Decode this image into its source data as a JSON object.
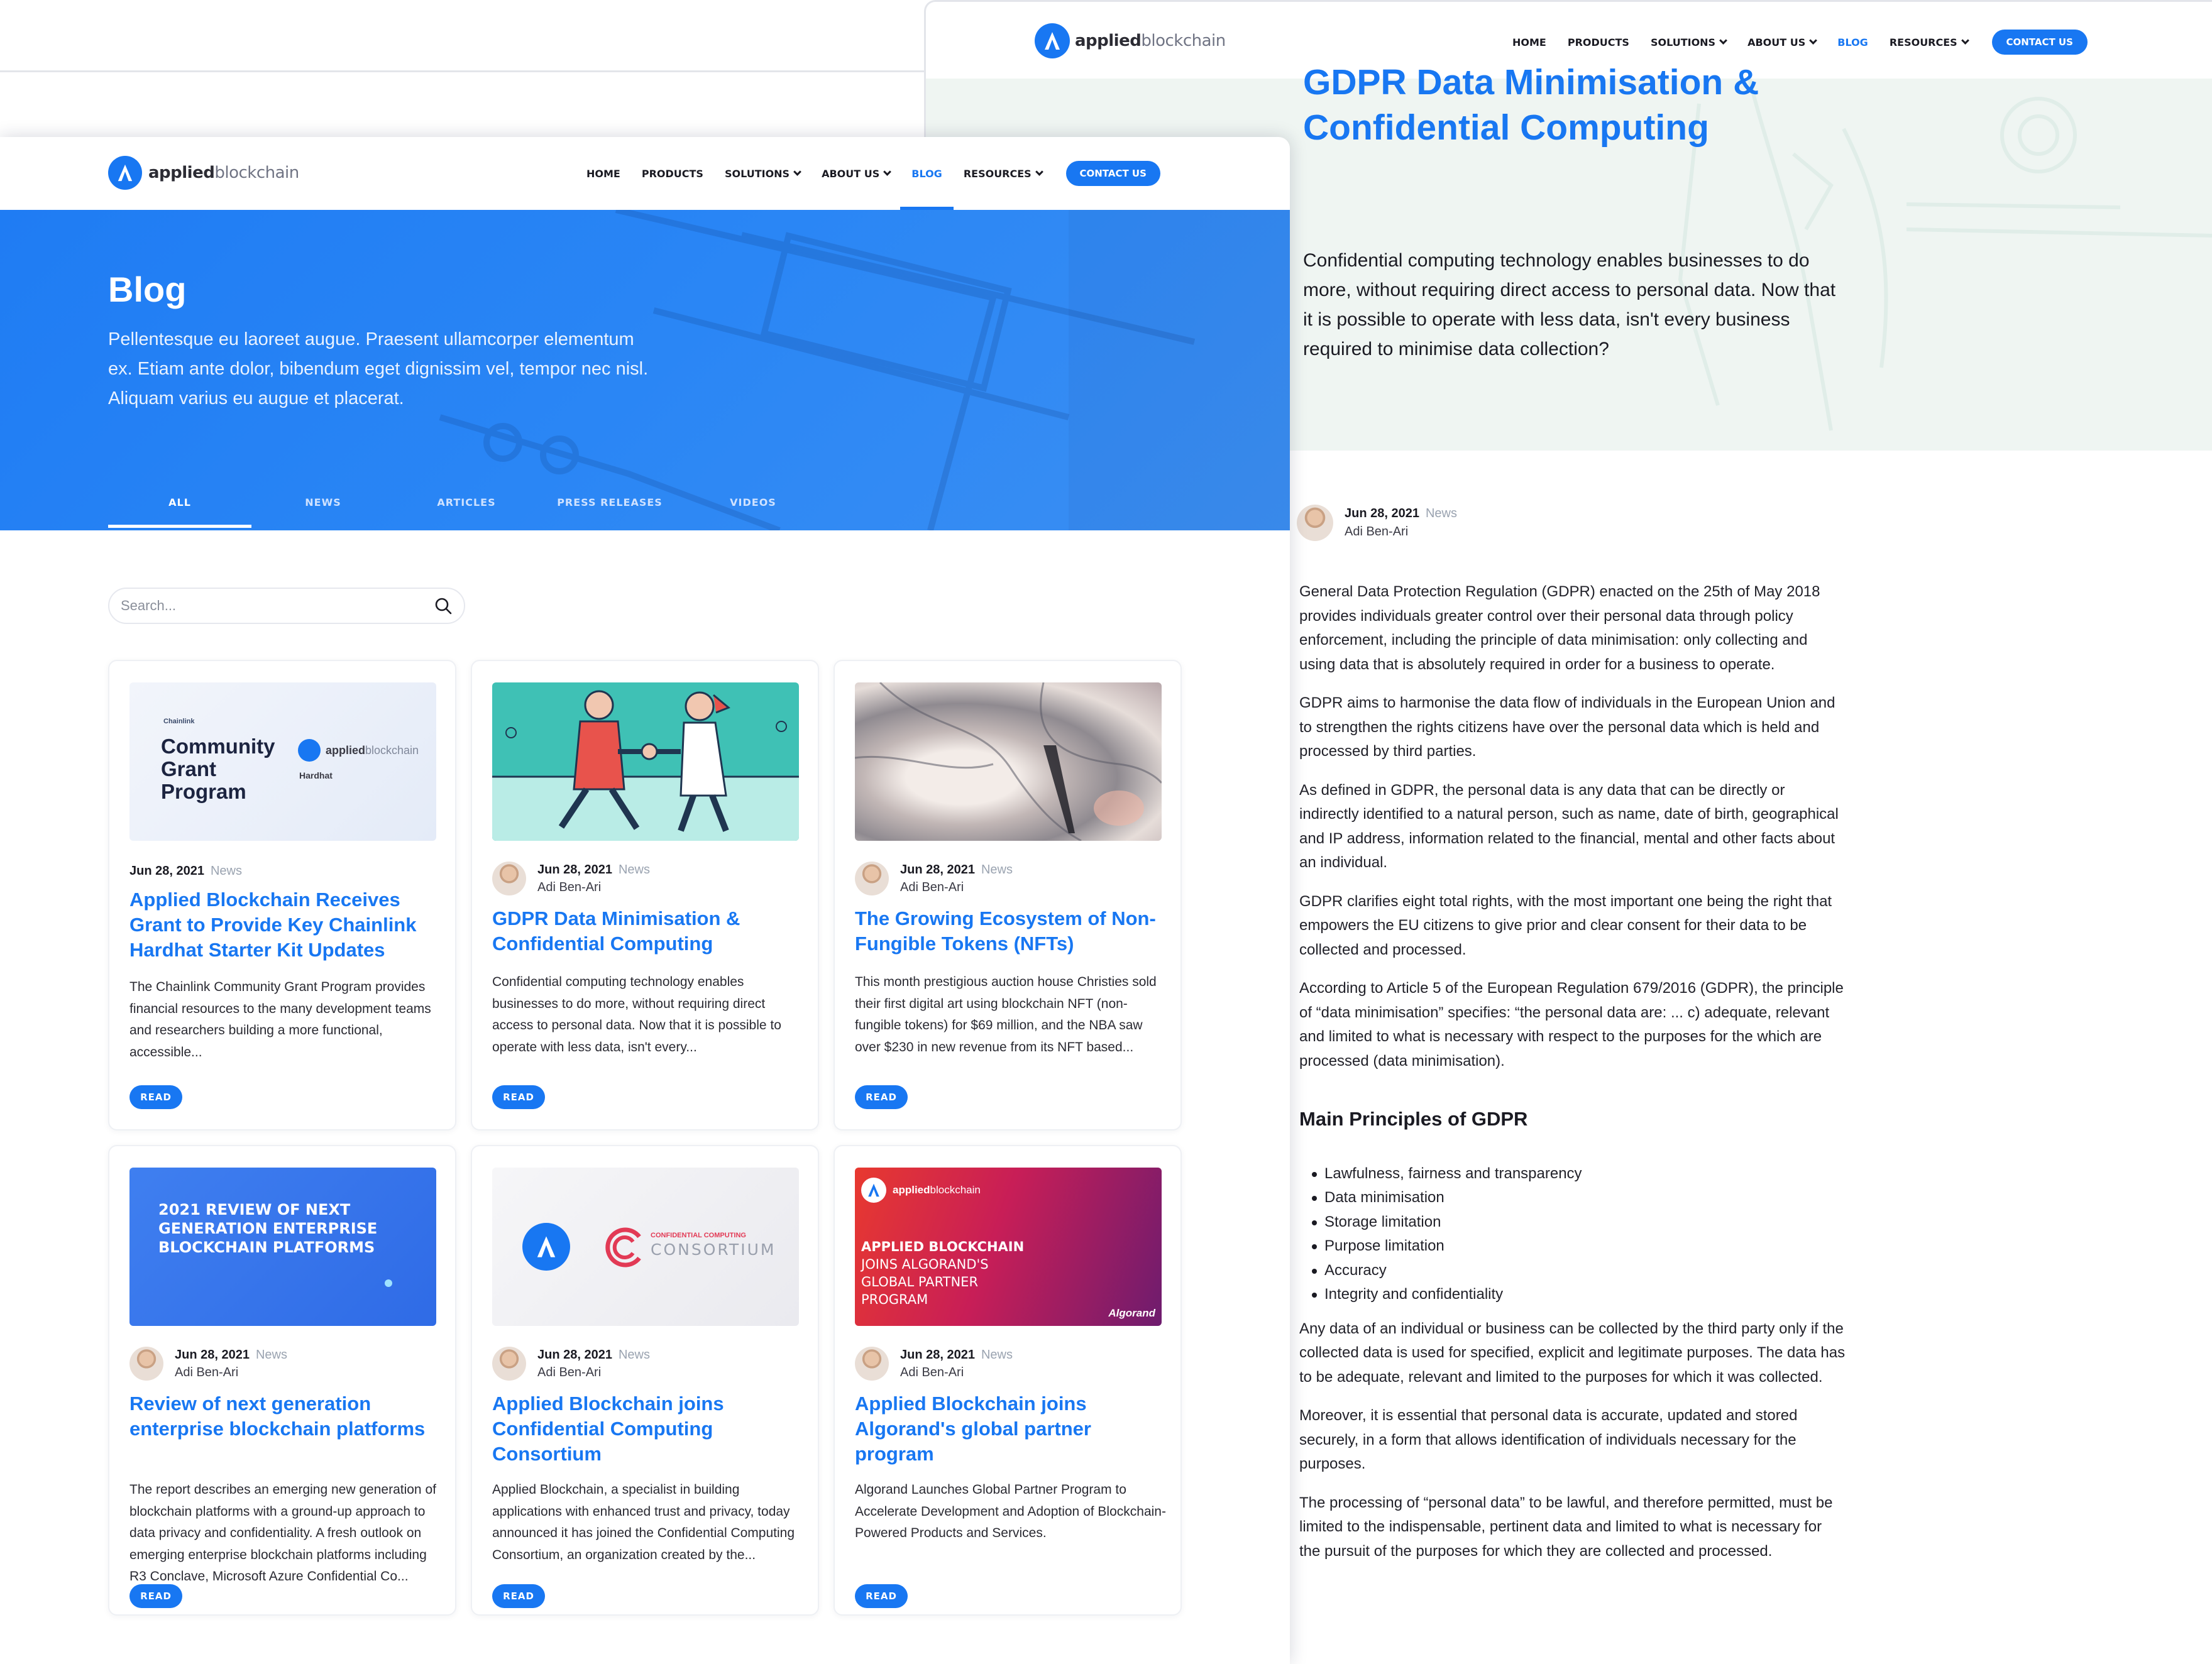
{
  "brand": {
    "logo_bold": "applied",
    "logo_light": "blockchain"
  },
  "nav": {
    "home": "HOME",
    "products": "PRODUCTS",
    "solutions": "SOLUTIONS",
    "about": "ABOUT US",
    "blog": "BLOG",
    "resources": "RESOURCES",
    "contact": "CONTACT US"
  },
  "colors": {
    "accent": "#1877f2",
    "hero_blue": "#2a86f5",
    "muted": "#9aa3b0"
  },
  "blog_page": {
    "title": "Blog",
    "description": "Pellentesque eu laoreet augue. Praesent ullamcorper elementum ex. Etiam ante dolor, bibendum eget dignissim vel, tempor nec nisl. Aliquam varius eu augue et placerat.",
    "tabs": [
      "ALL",
      "NEWS",
      "ARTICLES",
      "PRESS RELEASES",
      "VIDEOS"
    ],
    "active_tab": "ALL",
    "search_placeholder": "Search...",
    "read_label": "READ",
    "cards": [
      {
        "date": "Jun 28, 2021",
        "category": "News",
        "author": "",
        "title": "Applied Blockchain Receives Grant to Provide Key Chainlink Hardhat Starter Kit Updates",
        "excerpt": "The Chainlink Community Grant Program provides financial resources to the many development teams and researchers building a more functional, accessible...",
        "thumb_text": "Community Grant Program",
        "thumb_small": "Chainlink",
        "thumb_sub": "Hardhat"
      },
      {
        "date": "Jun 28, 2021",
        "category": "News",
        "author": "Adi Ben-Ari",
        "title": "GDPR Data Minimisation & Confidential Computing",
        "excerpt": "Confidential computing technology enables businesses to do more, without requiring direct access to personal data. Now that it is possible to operate with less data, isn't every..."
      },
      {
        "date": "Jun 28, 2021",
        "category": "News",
        "author": "Adi Ben-Ari",
        "title": "The Growing Ecosystem of Non-Fungible Tokens (NFTs)",
        "excerpt": "This month prestigious auction house Christies sold their first digital art using blockchain NFT (non-fungible tokens) for $69 million, and the NBA saw over $230 in new revenue from its NFT based..."
      },
      {
        "date": "Jun 28, 2021",
        "category": "News",
        "author": "Adi Ben-Ari",
        "title": "Review of next generation enterprise blockchain platforms",
        "excerpt": "The report describes an emerging new generation of blockchain platforms with a ground-up approach to data privacy and confidentiality. A fresh outlook on emerging enterprise blockchain platforms including R3 Conclave, Microsoft Azure Confidential Co...",
        "thumb_text": "2021 REVIEW OF NEXT GENERATION ENTERPRISE BLOCKCHAIN PLATFORMS"
      },
      {
        "date": "Jun 28, 2021",
        "category": "News",
        "author": "Adi Ben-Ari",
        "title": "Applied Blockchain joins Confidential Computing Consortium",
        "excerpt": "Applied Blockchain, a specialist in building applications with enhanced trust and privacy, today announced it has joined the Confidential Computing Consortium, an organization created by the...",
        "thumb_small": "CONFIDENTIAL COMPUTING",
        "thumb_text": "CONSORTIUM"
      },
      {
        "date": "Jun 28, 2021",
        "category": "News",
        "author": "Adi Ben-Ari",
        "title": "Applied Blockchain joins Algorand's global partner program",
        "excerpt": "Algorand Launches Global Partner Program to Accelerate Development and Adoption of Blockchain-Powered Products and Services.",
        "thumb_line1": "APPLIED BLOCKCHAIN",
        "thumb_line2": "JOINS ALGORAND'S",
        "thumb_line3": "GLOBAL PARTNER",
        "thumb_line4": "PROGRAM",
        "thumb_brand": "Algorand"
      }
    ]
  },
  "article": {
    "title": "GDPR Data Minimisation & Confidential Computing",
    "lead": "Confidential computing technology enables businesses to do more, without requiring direct access to personal data. Now that it is possible to operate with less data, isn't every business required to minimise data collection?",
    "date": "Jun 28, 2021",
    "category": "News",
    "author": "Adi Ben-Ari",
    "paragraphs": [
      "General Data Protection Regulation (GDPR) enacted on the 25th of May 2018 provides individuals greater control over their personal data through policy enforcement, including the principle of data minimisation: only collecting and using data that is absolutely required in order for a business to operate.",
      "GDPR aims to harmonise the data flow of individuals in the European Union and to strengthen the rights citizens have over the personal data which is held and processed by third parties.",
      "As defined in GDPR, the personal data is any data that can be directly or indirectly identified to a natural person, such as name, date of birth, geographical and IP address, information related to the financial, mental and other facts about an individual.",
      "GDPR clarifies eight total rights, with the most important one being the right that empowers the EU citizens to give prior and clear consent for their data to be collected and processed.",
      "According to Article 5 of the European Regulation 679/2016 (GDPR), the principle of “data minimisation” specifies: “the personal data are: ... c) adequate, relevant and limited to what is necessary with respect to the purposes for the which are processed (data minimisation)."
    ],
    "section_heading": "Main Principles of GDPR",
    "principles": [
      "Lawfulness, fairness and transparency",
      "Data minimisation",
      "Storage limitation",
      "Purpose limitation",
      "Accuracy",
      "Integrity and confidentiality"
    ],
    "paragraphs_after": [
      "Any data of an individual or business can be collected by the third party only if the collected data is used for specified, explicit and legitimate purposes. The data has to be adequate, relevant and limited to the purposes for which it was collected.",
      "Moreover, it is essential that personal data is accurate, updated and stored securely, in a form that allows identification of individuals necessary for the purposes.",
      "The processing of “personal data” to be lawful, and therefore permitted, must be limited to the indispensable, pertinent data and limited to what is necessary for the pursuit of the purposes for which they are collected and processed."
    ]
  }
}
